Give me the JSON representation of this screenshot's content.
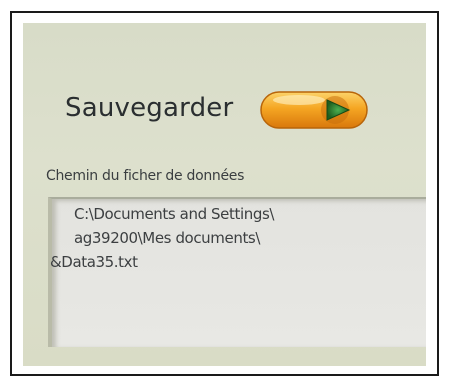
{
  "save": {
    "label": "Sauvegarder"
  },
  "icons": {
    "save_button": "orange-pill-play-icon"
  },
  "path": {
    "label": "Chemin du ficher de données",
    "lines": [
      "C:\\Documents and Settings\\",
      "ag39200\\Mes documents\\",
      "&Data35.txt"
    ]
  },
  "colors": {
    "button_orange": "#f29b17",
    "button_arrow": "#2e7a2e",
    "panel_bg": "#d9dcc6"
  }
}
